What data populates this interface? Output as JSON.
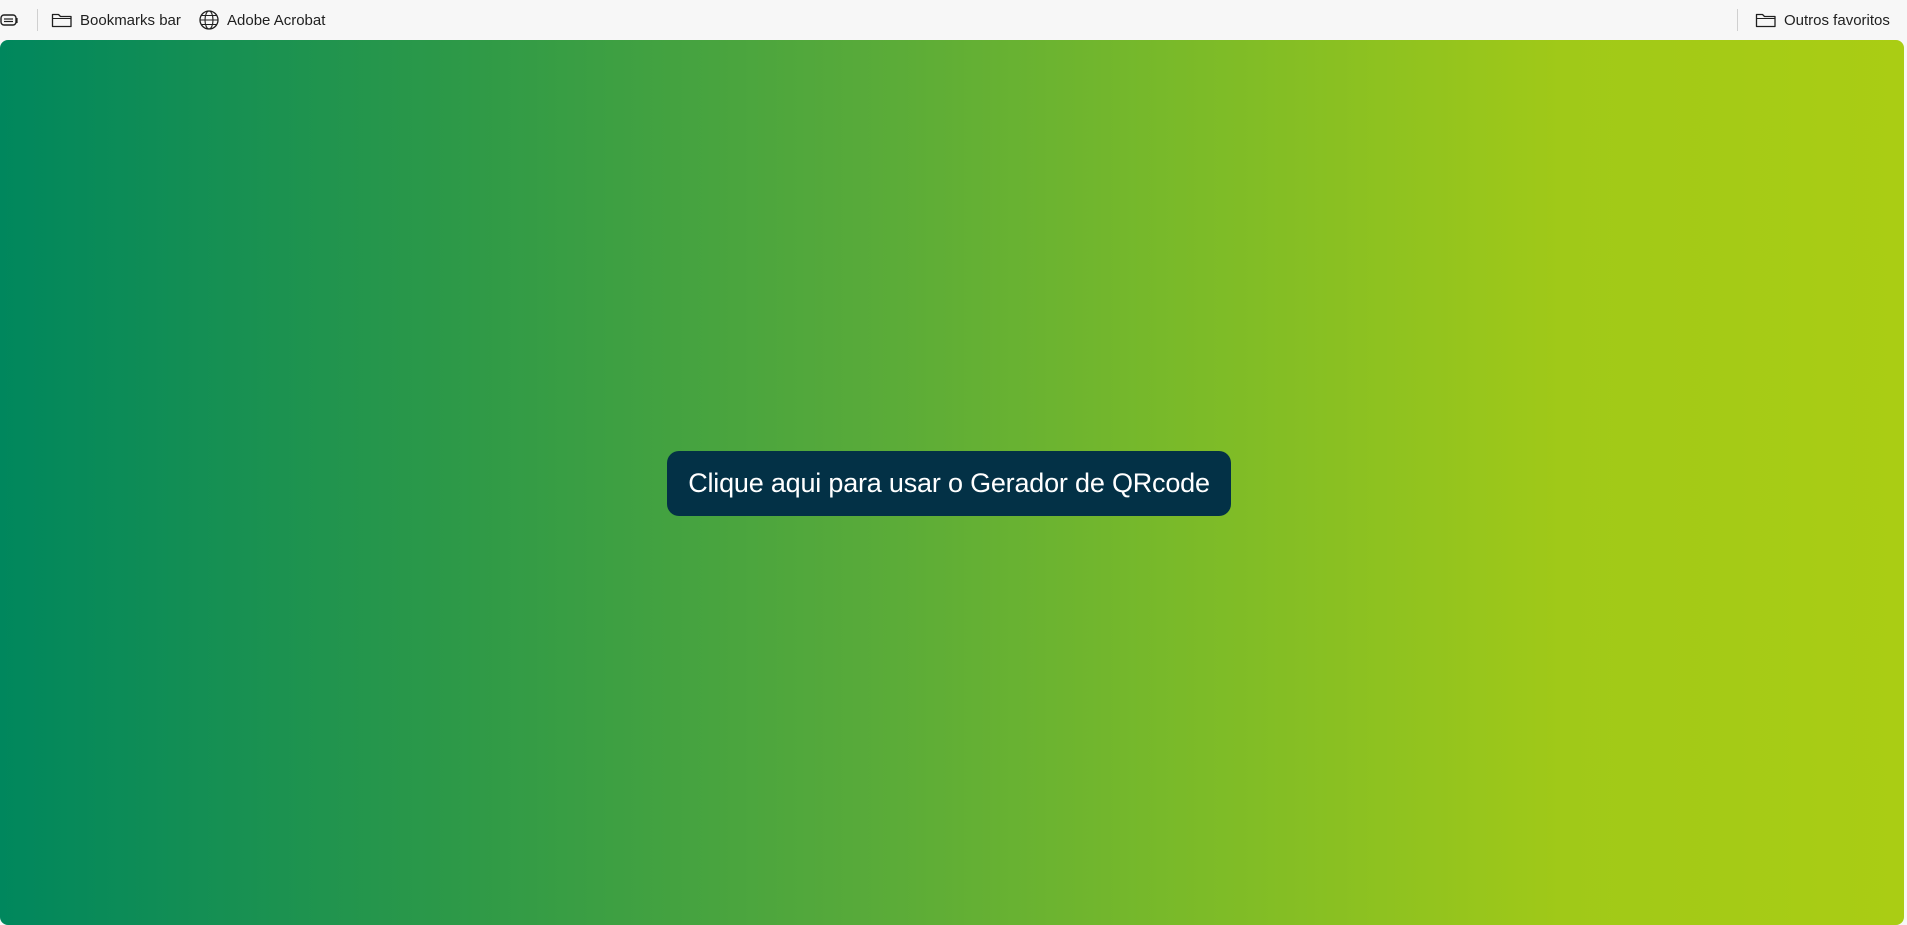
{
  "bookmarks_bar": {
    "items": [
      {
        "label": "Bookmarks bar",
        "icon": "folder-icon"
      },
      {
        "label": "Adobe Acrobat",
        "icon": "globe-icon"
      }
    ],
    "other_favorites": {
      "label": "Outros favoritos",
      "icon": "folder-icon"
    }
  },
  "page": {
    "background_colors": [
      "#00875d",
      "#57aa3a",
      "#aacd14"
    ],
    "cta_button": {
      "label": "Clique aqui para usar o Gerador de QRcode",
      "color": "#033146"
    }
  }
}
